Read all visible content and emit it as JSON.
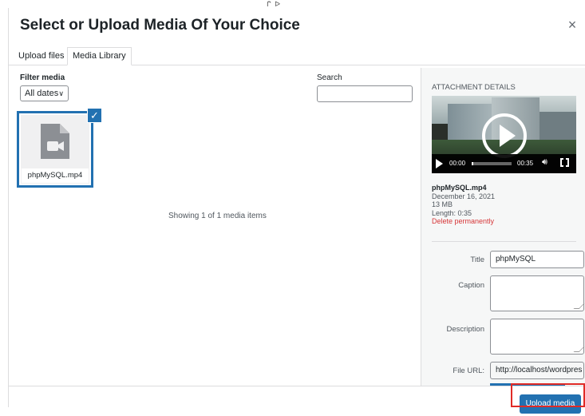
{
  "top_mark": "ᒋ ᐅ",
  "modal": {
    "title": "Select or Upload Media Of Your Choice",
    "close_glyph": "×"
  },
  "tabs": [
    {
      "label": "Upload files",
      "active": false
    },
    {
      "label": "Media Library",
      "active": true
    }
  ],
  "toolbar": {
    "filter_label": "Filter media",
    "date_filter_value": "All dates",
    "search_label": "Search",
    "search_value": ""
  },
  "media_items": [
    {
      "filename": "phpMySQL.mp4",
      "icon": "video-document-icon",
      "selected": true
    }
  ],
  "status": "Showing 1 of 1 media items",
  "attachment": {
    "heading": "ATTACHMENT DETAILS",
    "player": {
      "current_time": "00:00",
      "duration": "00:35",
      "progress": 0.0
    },
    "filename": "phpMySQL.mp4",
    "date": "December 16, 2021",
    "size": "13 MB",
    "length": "Length: 0:35",
    "delete_label": "Delete permanently",
    "fields": {
      "title_label": "Title",
      "title_value": "phpMySQL",
      "caption_label": "Caption",
      "caption_value": "",
      "description_label": "Description",
      "description_value": "",
      "url_label": "File URL:",
      "url_value": "http://localhost/wordpres"
    }
  },
  "footer": {
    "upload_label": "Upload media"
  },
  "colors": {
    "accent": "#2271b1",
    "danger": "#d63638",
    "highlight": "#e02b27"
  }
}
